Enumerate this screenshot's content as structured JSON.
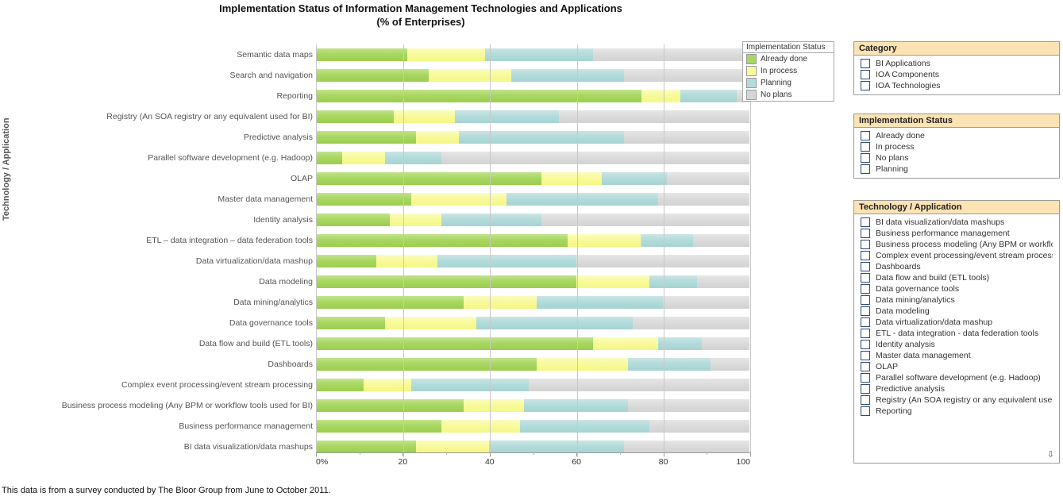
{
  "title": {
    "line1": "Implementation Status of Information Management Technologies and Applications",
    "line2": "(% of Enterprises)"
  },
  "axis": {
    "y_title": "Technology / Application",
    "x_ticks": [
      "0%",
      "20",
      "40",
      "60",
      "80",
      "100"
    ]
  },
  "legend": {
    "header": "Implementation Status",
    "items": [
      {
        "label": "Already  done",
        "color": "#a9d762"
      },
      {
        "label": "In process",
        "color": "#f8fa9c"
      },
      {
        "label": "Planning",
        "color": "#b3dcdb"
      },
      {
        "label": "No plans",
        "color": "#d6d6d6"
      }
    ]
  },
  "panels": {
    "category": {
      "header": "Category",
      "options": [
        "BI Applications",
        "IOA Components",
        "IOA Technologies"
      ]
    },
    "status": {
      "header": "Implementation Status",
      "options": [
        "Already  done",
        "In process",
        "No plans",
        "Planning"
      ]
    },
    "technology": {
      "header": "Technology / Application",
      "options": [
        "BI data visualization/data mashups",
        "Business performance management",
        "Business process modeling (Any BPM or workflow",
        "Complex event processing/event stream processin",
        "Dashboards",
        "Data flow and build (ETL tools)",
        "Data governance tools",
        "Data mining/analytics",
        "Data modeling",
        "Data virtualization/data mashup",
        "ETL - data integration - data federation tools",
        "Identity analysis",
        "Master data management",
        "OLAP",
        "Parallel software development (e.g. Hadoop)",
        "Predictive analysis",
        "Registry (An SOA registry or any equivalent used f",
        "Reporting"
      ],
      "scroll_icon": "⇩"
    }
  },
  "footer": {
    "note": "This data is from a survey conducted by The Bloor Group from June to October 2011."
  },
  "chart_data": {
    "type": "bar",
    "orientation": "horizontal",
    "stacked": true,
    "title": "Implementation Status of Information Management Technologies and Applications (% of Enterprises)",
    "xlabel": "",
    "ylabel": "Technology / Application",
    "xlim": [
      0,
      100
    ],
    "xticks": [
      0,
      20,
      40,
      60,
      80,
      100
    ],
    "grid": true,
    "legend_position": "top-right",
    "series": [
      {
        "name": "Already  done",
        "color": "#a9d762"
      },
      {
        "name": "In process",
        "color": "#f8fa9c"
      },
      {
        "name": "Planning",
        "color": "#b3dcdb"
      },
      {
        "name": "No plans",
        "color": "#d6d6d6"
      }
    ],
    "categories": [
      "Semantic data maps",
      "Search and navigation",
      "Reporting",
      "Registry (An SOA registry or any equivalent used for BI)",
      "Predictive analysis",
      "Parallel software development (e.g. Hadoop)",
      "OLAP",
      "Master data management",
      "Identity analysis",
      "ETL – data integration – data federation tools",
      "Data virtualization/data mashup",
      "Data modeling",
      "Data mining/analytics",
      "Data governance tools",
      "Data flow and build (ETL tools)",
      "Dashboards",
      "Complex event processing/event stream processing",
      "Business process modeling (Any BPM or workflow tools used for BI)",
      "Business performance management",
      "BI data visualization/data mashups"
    ],
    "rows": [
      {
        "category": "Semantic data maps",
        "values": [
          21,
          18,
          25,
          36
        ]
      },
      {
        "category": "Search and navigation",
        "values": [
          26,
          19,
          26,
          29
        ]
      },
      {
        "category": "Reporting",
        "values": [
          75,
          9,
          13,
          3
        ]
      },
      {
        "category": "Registry (An SOA registry or any equivalent used for BI)",
        "values": [
          18,
          14,
          24,
          44
        ]
      },
      {
        "category": "Predictive analysis",
        "values": [
          23,
          10,
          38,
          29
        ]
      },
      {
        "category": "Parallel software development (e.g. Hadoop)",
        "values": [
          6,
          10,
          13,
          71
        ]
      },
      {
        "category": "OLAP",
        "values": [
          52,
          14,
          15,
          19
        ]
      },
      {
        "category": "Master data management",
        "values": [
          22,
          22,
          35,
          21
        ]
      },
      {
        "category": "Identity analysis",
        "values": [
          17,
          12,
          23,
          48
        ]
      },
      {
        "category": "ETL – data integration – data federation tools",
        "values": [
          58,
          17,
          12,
          13
        ]
      },
      {
        "category": "Data virtualization/data mashup",
        "values": [
          14,
          14,
          32,
          40
        ]
      },
      {
        "category": "Data modeling",
        "values": [
          60,
          17,
          11,
          12
        ]
      },
      {
        "category": "Data mining/analytics",
        "values": [
          34,
          17,
          29,
          20
        ]
      },
      {
        "category": "Data governance tools",
        "values": [
          16,
          21,
          36,
          27
        ]
      },
      {
        "category": "Data flow and build (ETL tools)",
        "values": [
          64,
          15,
          10,
          11
        ]
      },
      {
        "category": "Dashboards",
        "values": [
          51,
          21,
          19,
          9
        ]
      },
      {
        "category": "Complex event processing/event stream processing",
        "values": [
          11,
          11,
          27,
          51
        ]
      },
      {
        "category": "Business process modeling (Any BPM or workflow tools used for BI)",
        "values": [
          34,
          14,
          24,
          28
        ]
      },
      {
        "category": "Business performance management",
        "values": [
          29,
          18,
          30,
          23
        ]
      },
      {
        "category": "BI data visualization/data mashups",
        "values": [
          23,
          17,
          31,
          29
        ]
      }
    ]
  }
}
